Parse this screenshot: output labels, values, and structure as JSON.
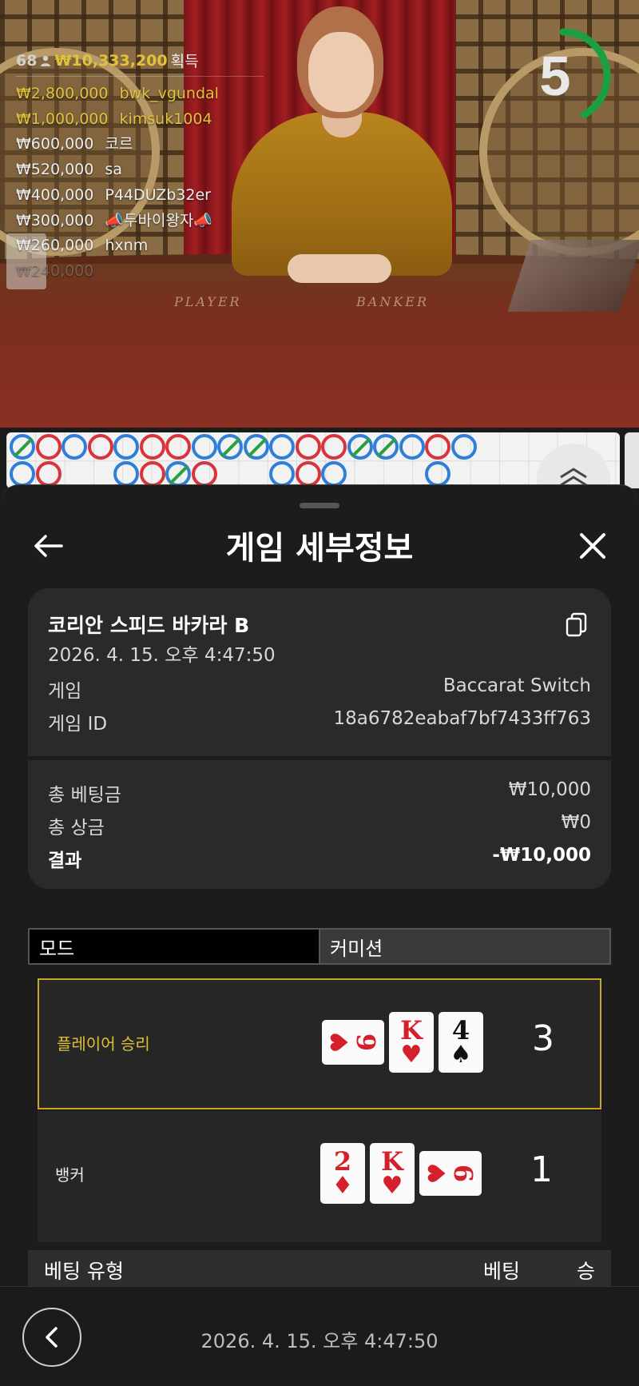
{
  "leaderboard": {
    "player_count": "68",
    "total_amount": "₩10,333,200",
    "total_label": "획득",
    "rows": [
      {
        "amount": "₩2,800,000",
        "name": "bwk_vgundal",
        "style": "gold"
      },
      {
        "amount": "₩1,000,000",
        "name": "kimsuk1004",
        "style": "gold"
      },
      {
        "amount": "₩600,000",
        "name": "코르",
        "style": "white"
      },
      {
        "amount": "₩520,000",
        "name": "sa",
        "style": "white"
      },
      {
        "amount": "₩400,000",
        "name": "P44DUZb32er",
        "style": "white"
      },
      {
        "amount": "₩300,000",
        "name": "📣두바이왕자📣",
        "style": "white"
      },
      {
        "amount": "₩260,000",
        "name": "hxnm",
        "style": "white"
      },
      {
        "amount": "₩240,000",
        "name": "",
        "style": "fade"
      }
    ]
  },
  "timer": {
    "value": "5",
    "remaining_fraction": 0.42,
    "color": "#1aa040"
  },
  "table_text": {
    "player": "PLAYER",
    "banker": "BANKER"
  },
  "roadmap": {
    "row1": [
      "T",
      "B",
      "P",
      "B",
      "P",
      "B",
      "B",
      "P",
      "T",
      "T",
      "P",
      "B",
      "B",
      "T",
      "T",
      "P",
      "B",
      "P"
    ],
    "row2": [
      "P",
      "B",
      "",
      "",
      "P",
      "B",
      "T",
      "B",
      "",
      "",
      "P",
      "B",
      "P",
      "",
      "",
      "",
      "P",
      ""
    ]
  },
  "sheet": {
    "title": "게임 세부정보"
  },
  "game": {
    "name": "코리안 스피드 바카라 B",
    "date": "2026. 4. 15. 오후 4:47:50",
    "game_label": "게임",
    "game_value": "Baccarat Switch",
    "id_label": "게임 ID",
    "id_value": "18a6782eabaf7bf7433ff763"
  },
  "totals": {
    "bet_label": "총 베팅금",
    "bet_value": "₩10,000",
    "win_label": "총 상금",
    "win_value": "₩0",
    "result_label": "결과",
    "result_value": "-₩10,000"
  },
  "tabs": [
    {
      "label": "모드",
      "active": true
    },
    {
      "label": "커미션",
      "active": false
    }
  ],
  "hands": {
    "player": {
      "label": "플레이어 승리",
      "score": "3",
      "cards": [
        {
          "rank": "6",
          "suit": "♥",
          "color": "red",
          "orientation": "side"
        },
        {
          "rank": "K",
          "suit": "♥",
          "color": "red",
          "orientation": "upright"
        },
        {
          "rank": "4",
          "suit": "♠",
          "color": "black",
          "orientation": "upright"
        }
      ]
    },
    "banker": {
      "label": "뱅커",
      "score": "1",
      "cards": [
        {
          "rank": "2",
          "suit": "♦",
          "color": "red",
          "orientation": "upright"
        },
        {
          "rank": "K",
          "suit": "♥",
          "color": "red",
          "orientation": "upright"
        },
        {
          "rank": "9",
          "suit": "♥",
          "color": "red",
          "orientation": "side"
        }
      ]
    }
  },
  "bet_table": {
    "col_type": "베팅 유형",
    "col_bet": "베팅",
    "col_win": "승"
  },
  "footer": {
    "time": "2026. 4. 15. 오후 4:47:50"
  },
  "colors": {
    "accent_gold": "#e2c23a",
    "player_blue": "#2f7fd8",
    "banker_red": "#d8343a",
    "tie_green": "#2aa040"
  }
}
